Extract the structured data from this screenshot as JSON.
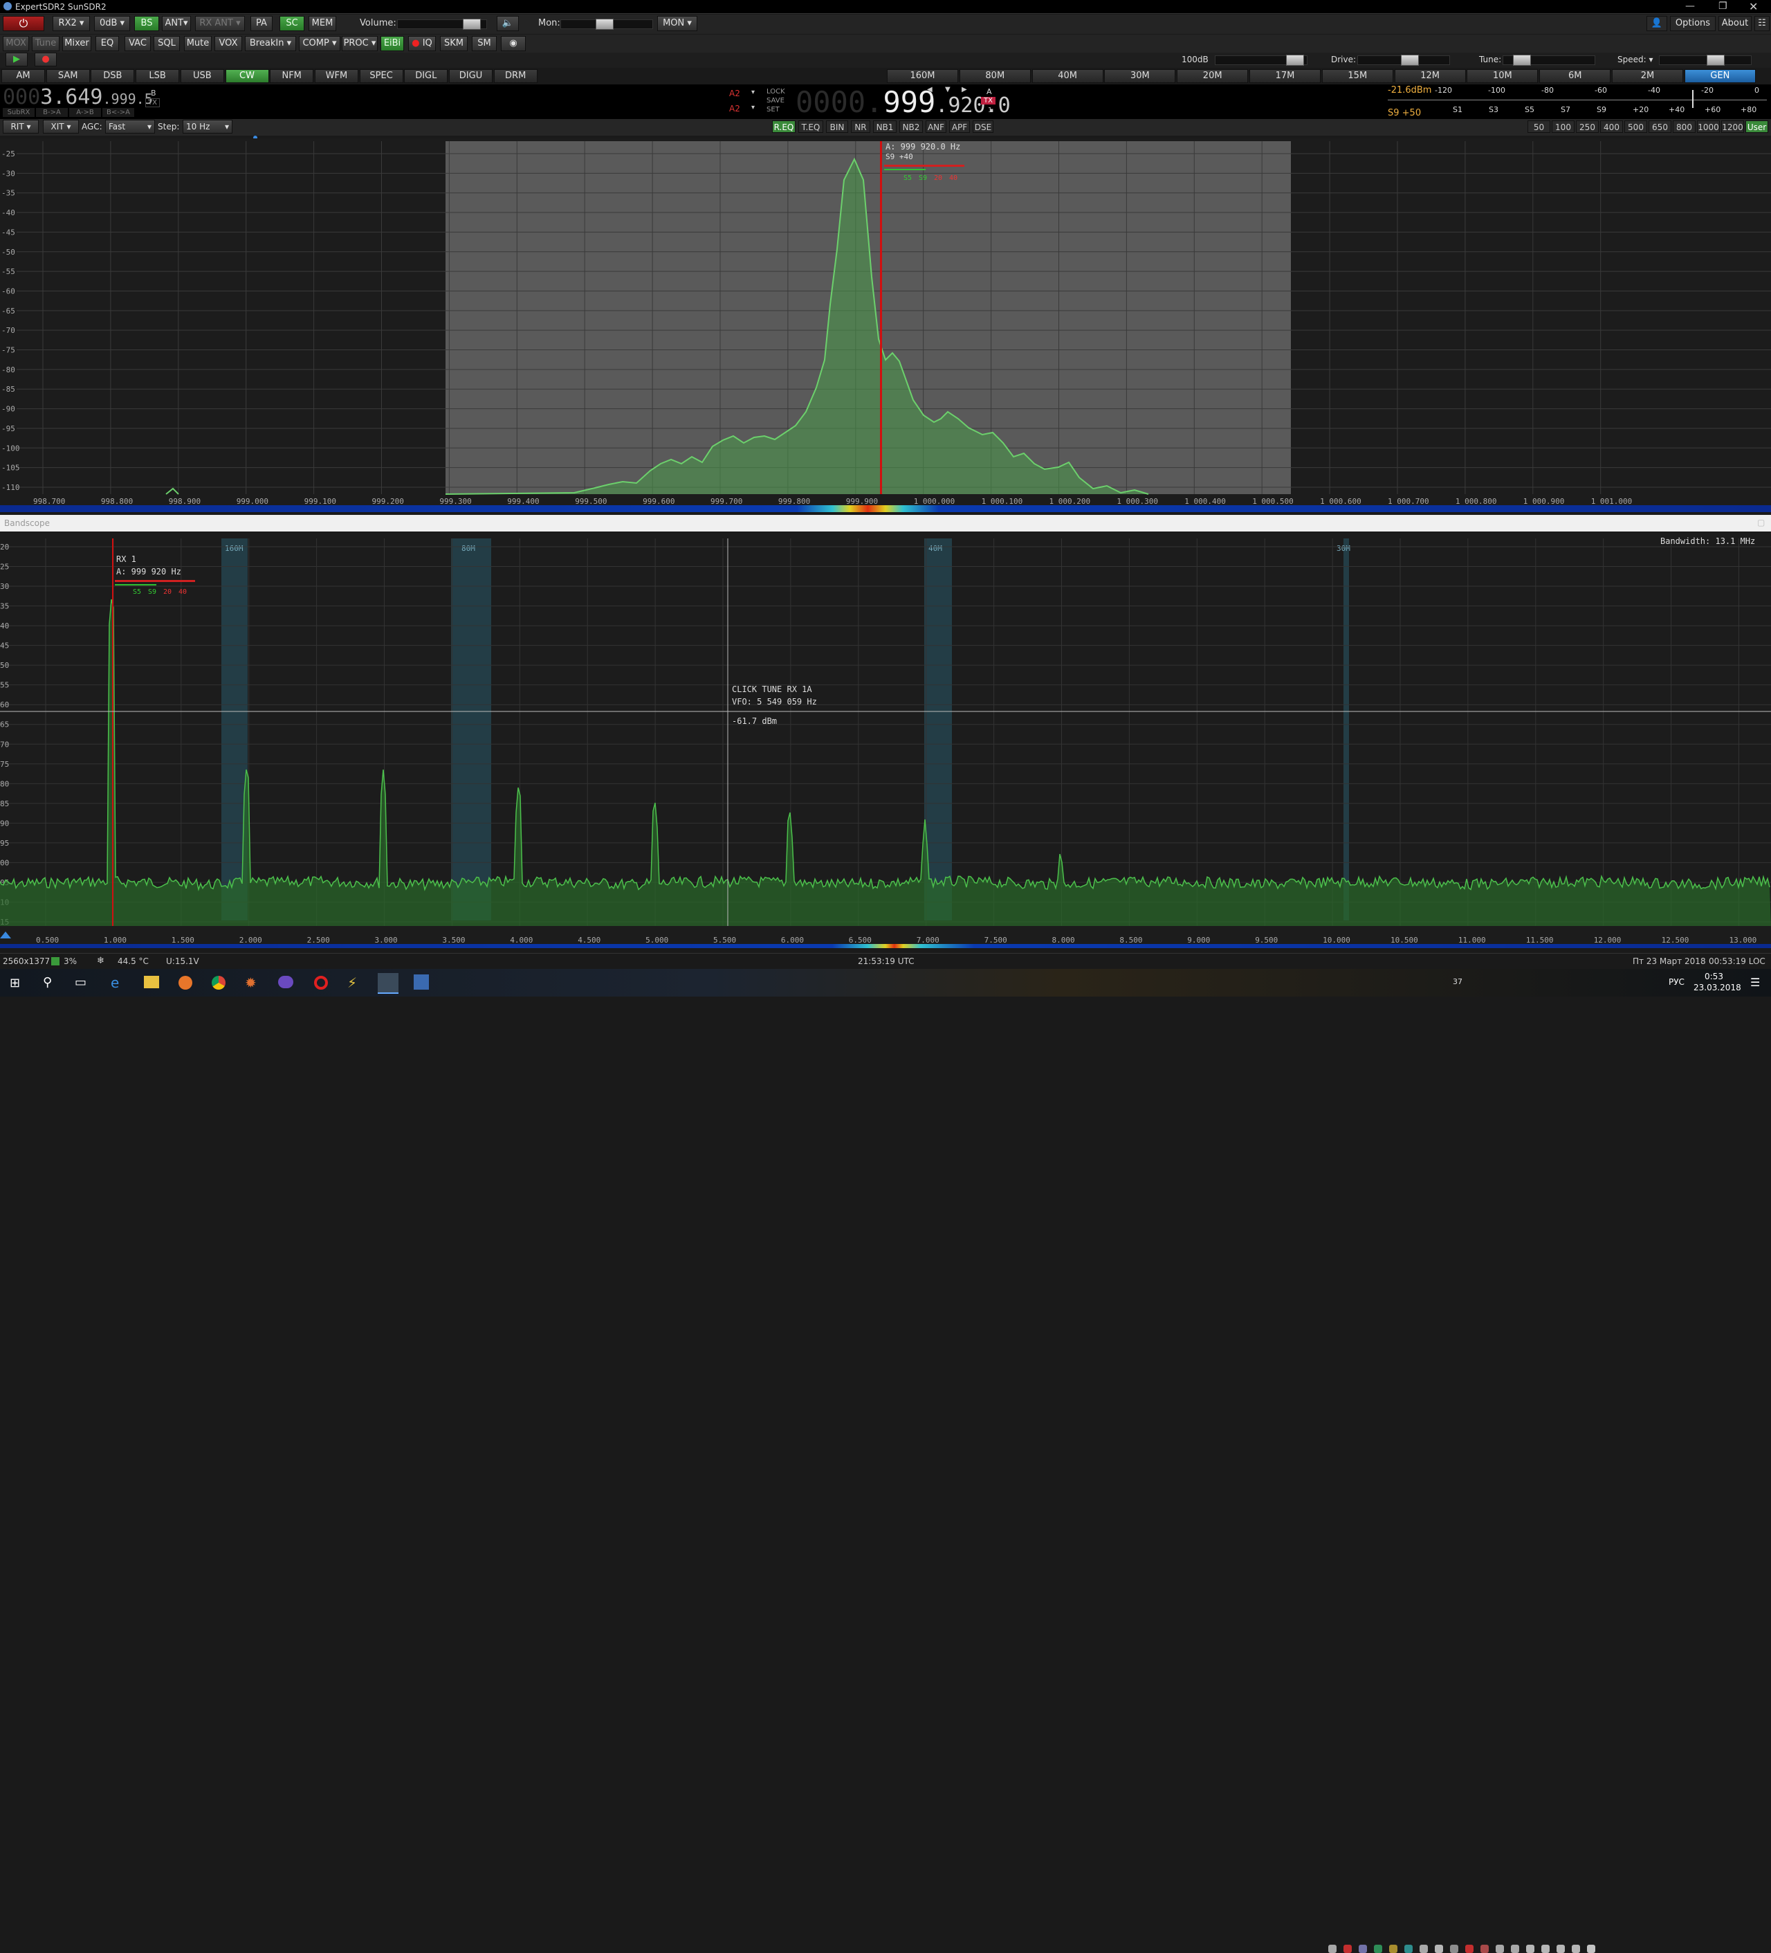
{
  "window": {
    "title": "ExpertSDR2 SunSDR2",
    "options": "Options",
    "about": "About"
  },
  "toolbar1": {
    "rx": "RX2",
    "att": "0dB",
    "bs": "BS",
    "ant": "ANT",
    "rxant": "RX ANT",
    "pa": "PA",
    "sc": "SC",
    "mem": "MEM",
    "volume": "Volume:",
    "mon": "Mon:",
    "mon_btn": "MON"
  },
  "toolbar2": {
    "mox": "MOX",
    "tune": "Tune",
    "mixer": "Mixer",
    "eq": "EQ",
    "vac": "VAC",
    "sql": "SQL",
    "mute": "Mute",
    "vox": "VOX",
    "breakin": "BreakIn",
    "comp": "COMP",
    "proc": "PROC",
    "eibi": "EiBi",
    "iq": "IQ",
    "skm": "SKM",
    "sm": "SM"
  },
  "row3": {
    "atten": "100dB",
    "drive": "Drive:",
    "tune": "Tune:",
    "speed": "Speed:"
  },
  "modes": [
    "AM",
    "SAM",
    "DSB",
    "LSB",
    "USB",
    "CW",
    "NFM",
    "WFM",
    "SPEC",
    "DIGL",
    "DIGU",
    "DRM"
  ],
  "active_mode": "CW",
  "bands": [
    "160M",
    "80M",
    "40M",
    "30M",
    "20M",
    "17M",
    "15M",
    "12M",
    "10M",
    "6M",
    "2M",
    "GEN"
  ],
  "active_band": "GEN",
  "vfo_b": {
    "dim": "000",
    "bright": "3.649",
    "small": ".999.5",
    "label": "B",
    "tx": "TX"
  },
  "sub_buttons": [
    "SubRX",
    "B->A",
    "A->B",
    "B<->A"
  ],
  "vfo_a": {
    "dim": "0000.",
    "bright": "999",
    "small": ".920.0",
    "label": "A",
    "tx": "TX",
    "rx_num": "1"
  },
  "a2": [
    "A2",
    "A2"
  ],
  "lock": [
    "LOCK",
    "SAVE",
    "SET"
  ],
  "meter": {
    "dbm": "-21.6dBm",
    "s_value": "S9 +50",
    "top_scale": [
      "-120",
      "-100",
      "-80",
      "-60",
      "-40",
      "-20",
      "0"
    ],
    "bottom_scale": [
      "S1",
      "S3",
      "S5",
      "S7",
      "S9",
      "+20",
      "+40",
      "+60",
      "+80"
    ]
  },
  "row5": {
    "rit": "RIT",
    "xit": "XIT",
    "agc": "AGC:",
    "agc_val": "Fast",
    "step": "Step:",
    "step_val": "10 Hz"
  },
  "dsp": [
    "R.EQ",
    "T.EQ",
    "BIN",
    "NR",
    "NB1",
    "NB2",
    "ANF",
    "APF",
    "DSE"
  ],
  "bw_buttons": [
    "50",
    "100",
    "250",
    "400",
    "500",
    "650",
    "800",
    "1000",
    "1200",
    "User"
  ],
  "panadapter": {
    "db_ticks": [
      "-25",
      "-30",
      "-35",
      "-40",
      "-45",
      "-50",
      "-55",
      "-60",
      "-65",
      "-70",
      "-75",
      "-80",
      "-85",
      "-90",
      "-95",
      "-100",
      "-105",
      "-110"
    ],
    "freq_ticks": [
      "998.700",
      "998.800",
      "998.900",
      "999.000",
      "999.100",
      "999.200",
      "999.300",
      "999.400",
      "999.500",
      "999.600",
      "999.700",
      "999.800",
      "999.900",
      "1 000.000",
      "1 000.100",
      "1 000.200",
      "1 000.300",
      "1 000.400",
      "1 000.500",
      "1 000.600",
      "1 000.700",
      "1 000.800",
      "1 000.900",
      "1 001.000"
    ],
    "vfo_label": "A: 999 920.0 Hz",
    "s_label": "S9 +40",
    "s_marks": [
      "S5",
      "S9",
      "20",
      "40"
    ]
  },
  "bandscope": {
    "title": "Bandscope",
    "bandwidth": "Bandwidth: 13.1 MHz",
    "band_labels": [
      "160M",
      "80M",
      "40M",
      "30M"
    ],
    "rx_label": "RX 1",
    "vfo_label": "A: 999 920 Hz",
    "s_marks": [
      "S5",
      "S9",
      "20",
      "40"
    ],
    "tooltip": [
      "CLICK TUNE RX 1A",
      "VFO: 5 549 059 Hz",
      "-61.7 dBm"
    ],
    "db_ticks": [
      "20",
      "25",
      "30",
      "35",
      "40",
      "45",
      "50",
      "55",
      "60",
      "65",
      "70",
      "75",
      "80",
      "85",
      "90",
      "95",
      "00",
      "05",
      "10",
      "15"
    ],
    "freq_ticks": [
      "0.500",
      "1.000",
      "1.500",
      "2.000",
      "2.500",
      "3.000",
      "3.500",
      "4.000",
      "4.500",
      "5.000",
      "5.500",
      "6.000",
      "6.500",
      "7.000",
      "7.500",
      "8.000",
      "8.500",
      "9.000",
      "9.500",
      "10.000",
      "10.500",
      "11.000",
      "11.500",
      "12.000",
      "12.500",
      "13.000"
    ]
  },
  "status": {
    "resolution": "2560x1377",
    "cpu": "3%",
    "temp": "44.5 °C",
    "voltage": "U:15.1V",
    "utc": "21:53:19 UTC",
    "date": "Пт 23 Март 2018",
    "loc": "00:53:19 LOC"
  },
  "taskbar": {
    "lang": "РУС",
    "time": "0:53",
    "date": "23.03.2018",
    "tray_num": "37"
  }
}
